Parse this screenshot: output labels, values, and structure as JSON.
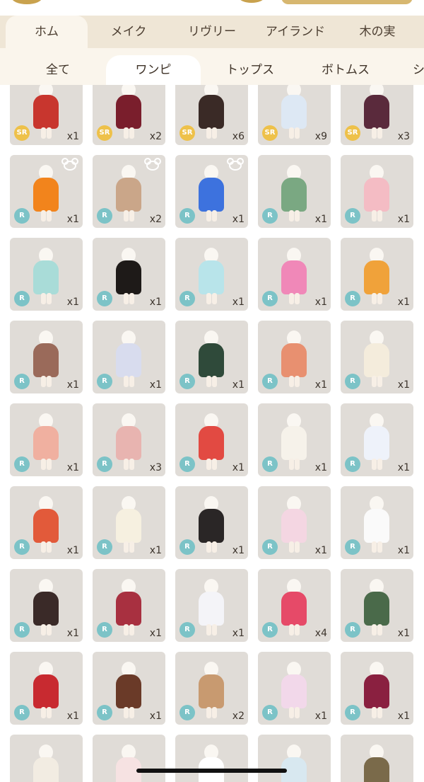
{
  "category_tabs": [
    {
      "label": "ホム",
      "active": true
    },
    {
      "label": "メイク",
      "active": false
    },
    {
      "label": "リヴリー",
      "active": false
    },
    {
      "label": "アイランド",
      "active": false
    },
    {
      "label": "木の実",
      "active": false
    }
  ],
  "sub_tabs": [
    {
      "label": "全て",
      "active": false
    },
    {
      "label": "ワンピ",
      "active": true
    },
    {
      "label": "トップス",
      "active": false
    },
    {
      "label": "ボトムス",
      "active": false
    },
    {
      "label": "シ",
      "active": false
    }
  ],
  "colors": {
    "tab_bar_bg": "#efe6d6",
    "active_tab_bg": "#faf5ec",
    "tile_bg": "#e0dcd7",
    "rarity_r": "#7cc3c7",
    "rarity_sr": "#eec14a"
  },
  "items": [
    {
      "rarity": "SR",
      "qty": "x1",
      "color": "#c8362e"
    },
    {
      "rarity": "SR",
      "qty": "x2",
      "color": "#7a1e2c"
    },
    {
      "rarity": "SR",
      "qty": "x6",
      "color": "#3a2a26"
    },
    {
      "rarity": "SR",
      "qty": "x9",
      "color": "#dde8f4"
    },
    {
      "rarity": "SR",
      "qty": "x3",
      "color": "#5a2a3c"
    },
    {
      "rarity": "R",
      "qty": "x1",
      "color": "#f2841c",
      "icon": "bear-ears-icon"
    },
    {
      "rarity": "R",
      "qty": "x2",
      "color": "#caa689",
      "icon": "bear-ears-icon"
    },
    {
      "rarity": "R",
      "qty": "x1",
      "color": "#3d72de",
      "icon": "bear-ears-icon"
    },
    {
      "rarity": "R",
      "qty": "x1",
      "color": "#7aa882"
    },
    {
      "rarity": "R",
      "qty": "x1",
      "color": "#f4bcc4"
    },
    {
      "rarity": "R",
      "qty": "x1",
      "color": "#a9dcd8"
    },
    {
      "rarity": "R",
      "qty": "x1",
      "color": "#1e1a18"
    },
    {
      "rarity": "R",
      "qty": "x1",
      "color": "#b8e4ea"
    },
    {
      "rarity": "R",
      "qty": "x1",
      "color": "#f088b8"
    },
    {
      "rarity": "R",
      "qty": "x1",
      "color": "#f0a23a"
    },
    {
      "rarity": "R",
      "qty": "x1",
      "color": "#9a6a5a"
    },
    {
      "rarity": "R",
      "qty": "x1",
      "color": "#d8dcee"
    },
    {
      "rarity": "R",
      "qty": "x1",
      "color": "#2f4a3a"
    },
    {
      "rarity": "R",
      "qty": "x1",
      "color": "#e89070"
    },
    {
      "rarity": "R",
      "qty": "x1",
      "color": "#f4ecdc"
    },
    {
      "rarity": "R",
      "qty": "x1",
      "color": "#f0b0a0"
    },
    {
      "rarity": "R",
      "qty": "x3",
      "color": "#e8b4b0"
    },
    {
      "rarity": "R",
      "qty": "x1",
      "color": "#e24a42"
    },
    {
      "rarity": "R",
      "qty": "x1",
      "color": "#f6f2ea"
    },
    {
      "rarity": "R",
      "qty": "x1",
      "color": "#eef2fa"
    },
    {
      "rarity": "R",
      "qty": "x1",
      "color": "#e25a3a"
    },
    {
      "rarity": "R",
      "qty": "x1",
      "color": "#f6f0e0"
    },
    {
      "rarity": "R",
      "qty": "x1",
      "color": "#2a2626"
    },
    {
      "rarity": "R",
      "qty": "x1",
      "color": "#f4d6e2"
    },
    {
      "rarity": "R",
      "qty": "x1",
      "color": "#fafafa"
    },
    {
      "rarity": "R",
      "qty": "x1",
      "color": "#3a2a28"
    },
    {
      "rarity": "R",
      "qty": "x1",
      "color": "#a83040"
    },
    {
      "rarity": "R",
      "qty": "x1",
      "color": "#f4f4f8"
    },
    {
      "rarity": "R",
      "qty": "x4",
      "color": "#e64a68"
    },
    {
      "rarity": "R",
      "qty": "x1",
      "color": "#4a6a4a"
    },
    {
      "rarity": "R",
      "qty": "x1",
      "color": "#c82a30"
    },
    {
      "rarity": "R",
      "qty": "x1",
      "color": "#6a3a28"
    },
    {
      "rarity": "R",
      "qty": "x2",
      "color": "#c89a70"
    },
    {
      "rarity": "R",
      "qty": "x1",
      "color": "#f2d8ea"
    },
    {
      "rarity": "R",
      "qty": "x1",
      "color": "#8a2040"
    },
    {
      "color": "#f2ece2"
    },
    {
      "color": "#f6e2e2"
    },
    {
      "color": "#ffffff"
    },
    {
      "color": "#d8e8f0"
    },
    {
      "color": "#7a6a4a"
    }
  ]
}
